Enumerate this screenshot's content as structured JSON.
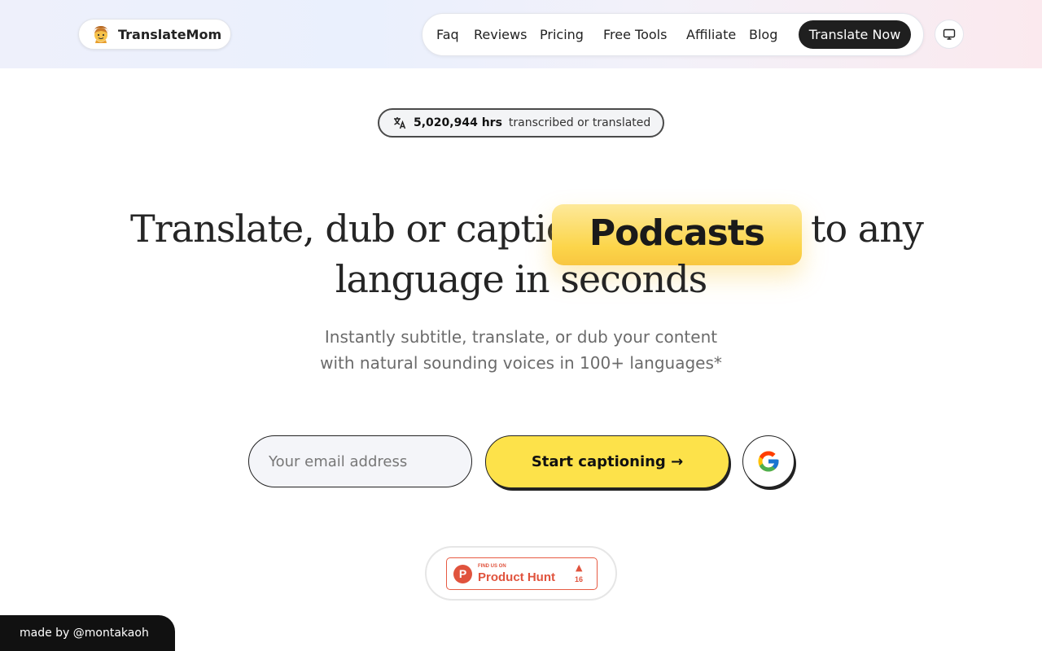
{
  "brand": {
    "name": "TranslateMom",
    "icon": "mascot-icon"
  },
  "nav": {
    "items": [
      "Faq",
      "Reviews",
      "Pricing",
      "Free Tools",
      "Affiliate",
      "Blog"
    ],
    "cta": "Translate Now",
    "theme_icon": "monitor-icon"
  },
  "stats": {
    "icon": "translate-icon",
    "value": "5,020,944 hrs",
    "suffix": "transcribed or translated"
  },
  "hero": {
    "line1_a": "Translate, dub or caption",
    "highlight": "Podcasts",
    "line1_b": "to any",
    "line2": "language in seconds"
  },
  "subtitle": {
    "line1": "Instantly subtitle, translate, or dub your content",
    "line2": "with natural sounding voices in 100+ languages*"
  },
  "signup": {
    "email_placeholder": "Your email address",
    "start_label": "Start captioning →",
    "google_icon": "google-icon"
  },
  "product_hunt": {
    "small": "FIND US ON",
    "name": "Product Hunt",
    "upvotes": "16"
  },
  "credit": "made by @montakaoh",
  "colors": {
    "accent_yellow": "#fde24a",
    "dark": "#1f1f1f",
    "product_hunt": "#e0533d"
  }
}
